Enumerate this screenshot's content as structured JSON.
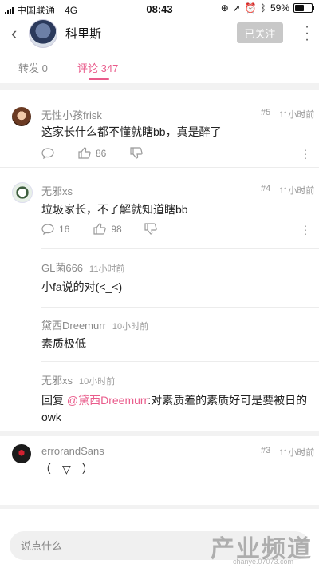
{
  "status_bar": {
    "carrier": "中国联通",
    "network": "4G",
    "time": "08:43",
    "battery_percent": "59%",
    "battery_level": 0.59
  },
  "header": {
    "username": "科里斯",
    "follow_button": "已关注",
    "back_icon": "chevron-left-icon",
    "more_icon": "vertical-ellipsis-icon"
  },
  "tabs": [
    {
      "label": "转发 0",
      "active": false
    },
    {
      "label": "评论 347",
      "active": true
    }
  ],
  "accent_color": "#e95b8b",
  "comments": [
    {
      "name": "无性小孩frisk",
      "floor": "#5",
      "time": "11小时前",
      "text": "这家长什么都不懂就瞎bb，真是醉了",
      "likes": "86",
      "replies": ""
    },
    {
      "name": "无邪xs",
      "floor": "#4",
      "time": "11小时前",
      "text": "垃圾家长，不了解就知道瞎bb",
      "replies": "16",
      "likes": "98"
    }
  ],
  "sub_replies": [
    {
      "name": "GL菌666",
      "time": "11小时前",
      "text": "小fa说的对(<_<)"
    },
    {
      "name": "黛西Dreemurr",
      "time": "10小时前",
      "text": "素质极低"
    },
    {
      "name": "无邪xs",
      "time": "10小时前",
      "reply_prefix": "回复 ",
      "mention": "@黛西Dreemurr",
      "text_after": ":对素质差的素质好可是要被日的",
      "text_line2": "owk"
    }
  ],
  "comment3": {
    "name": "errorandSans",
    "floor": "#3",
    "time": "11小时前",
    "text": "（￣▽￣）"
  },
  "comment_input": {
    "placeholder": "说点什么"
  },
  "watermark": {
    "main": "产业频道",
    "sub": "chanye.07073.com"
  }
}
